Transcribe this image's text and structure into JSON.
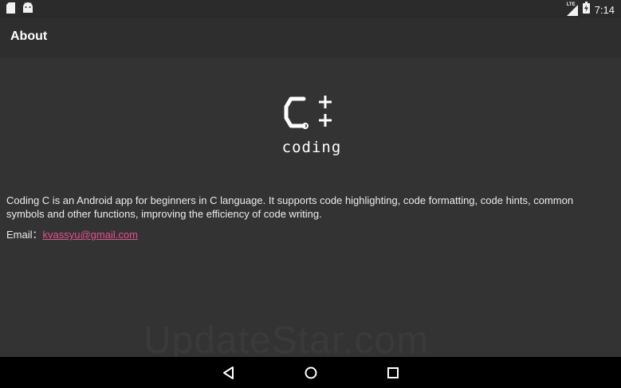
{
  "status_bar": {
    "time": "7:14",
    "network_label": "LTE",
    "icons": [
      "sd-card-icon",
      "android-icon",
      "lte-signal-icon",
      "battery-charging-icon"
    ]
  },
  "app_bar": {
    "title": "About"
  },
  "logo": {
    "mark": "C++",
    "subtitle": "coding"
  },
  "about": {
    "description": "Coding C is an Android app for beginners in C language. It supports code highlighting, code formatting, code hints, common symbols and other functions, improving the efficiency of code writing.",
    "email_label": "Email：",
    "email": "kvassyu@gmail.com"
  },
  "watermark": "UpdateStar.com",
  "nav_bar": {
    "icons": [
      "back-icon",
      "home-icon",
      "recents-icon"
    ]
  },
  "colors": {
    "background": "#333333",
    "app_bar": "#2e2e2e",
    "status_bar": "#2b2b2b",
    "link": "#e5508f",
    "nav_bar": "#000000"
  }
}
